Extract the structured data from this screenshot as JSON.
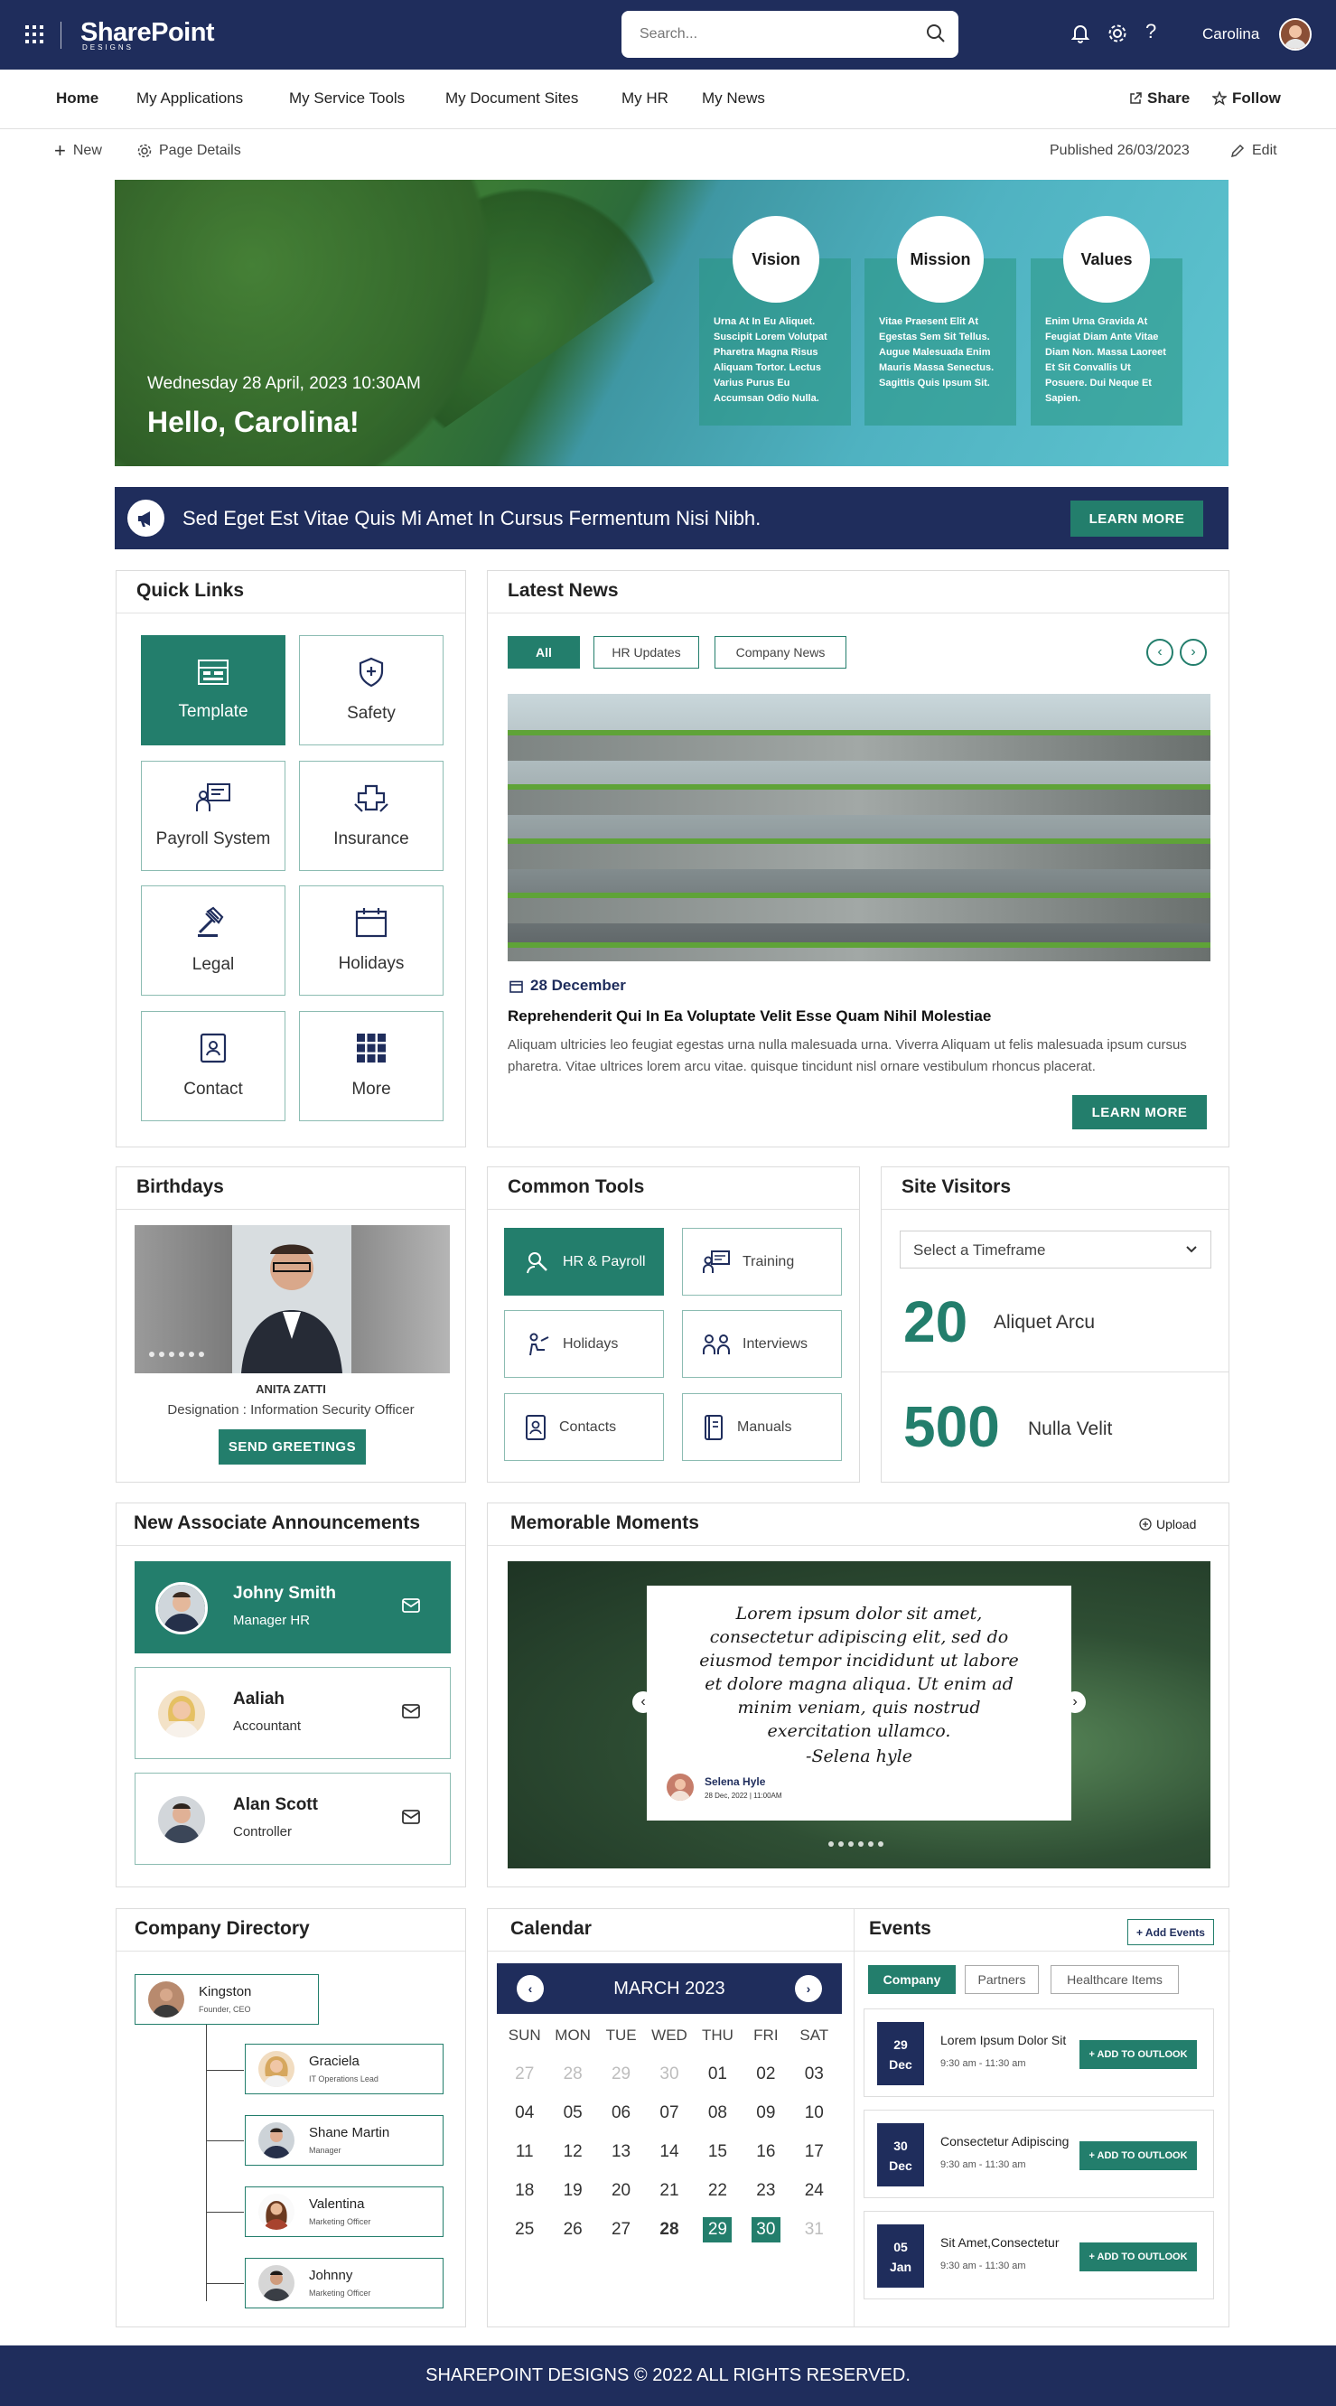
{
  "header": {
    "logo": "SharePoint",
    "logo_sub": "DESIGNS",
    "search_placeholder": "Search...",
    "user_name": "Carolina"
  },
  "nav": {
    "items": [
      "Home",
      "My Applications",
      "My Service Tools",
      "My Document Sites",
      "My HR",
      "My News"
    ],
    "share": "Share",
    "follow": "Follow"
  },
  "commands": {
    "new": "New",
    "page_details": "Page Details",
    "published": "Published 26/03/2023",
    "edit": "Edit"
  },
  "hero": {
    "date": "Wednesday 28 April, 2023  10:30AM",
    "greeting": "Hello, Carolina!",
    "cards": [
      {
        "title": "Vision",
        "text": "Urna At In Eu Aliquet. Suscipit Lorem Volutpat Pharetra Magna Risus Aliquam Tortor. Lectus Varius Purus Eu Accumsan Odio Nulla."
      },
      {
        "title": "Mission",
        "text": "Vitae Praesent Elit At Egestas Sem Sit Tellus. Augue Malesuada Enim Mauris Massa Senectus. Sagittis Quis Ipsum Sit."
      },
      {
        "title": "Values",
        "text": "Enim Urna Gravida At Feugiat Diam Ante Vitae Diam Non. Massa Laoreet Et Sit Convallis Ut Posuere. Dui Neque Et Sapien."
      }
    ]
  },
  "banner": {
    "text": "Sed Eget Est Vitae Quis Mi Amet In Cursus Fermentum Nisi Nibh.",
    "button": "LEARN MORE"
  },
  "quick_links": {
    "title": "Quick Links",
    "items": [
      "Template",
      "Safety",
      "Payroll System",
      "Insurance",
      "Legal",
      "Holidays",
      "Contact",
      "More"
    ]
  },
  "news": {
    "title": "Latest News",
    "filters": [
      "All",
      "HR Updates",
      "Company News"
    ],
    "date": "28 December",
    "headline": "Reprehenderit Qui In Ea Voluptate Velit Esse Quam Nihil Molestiae",
    "body": "Aliquam ultricies leo feugiat egestas urna nulla malesuada urna. Viverra Aliquam ut felis malesuada ipsum cursus pharetra. Vitae ultrices lorem arcu vitae. quisque tincidunt nisl ornare vestibulum rhoncus placerat.",
    "button": "LEARN MORE"
  },
  "birthdays": {
    "title": "Birthdays",
    "name": "ANITA ZATTI",
    "designation": "Designation : Information Security Officer",
    "button": "SEND GREETINGS"
  },
  "tools": {
    "title": "Common Tools",
    "items": [
      "HR & Payroll",
      "Training",
      "Holidays",
      "Interviews",
      "Contacts",
      "Manuals"
    ]
  },
  "visitors": {
    "title": "Site Visitors",
    "select": "Select a Timeframe",
    "stats": [
      {
        "value": "20",
        "label": "Aliquet Arcu"
      },
      {
        "value": "500",
        "label": "Nulla Velit"
      }
    ]
  },
  "associates": {
    "title": "New Associate Announcements",
    "items": [
      {
        "name": "Johny Smith",
        "role": "Manager HR"
      },
      {
        "name": "Aaliah",
        "role": "Accountant"
      },
      {
        "name": "Alan Scott",
        "role": "Controller"
      }
    ]
  },
  "moments": {
    "title": "Memorable Moments",
    "upload": "Upload",
    "quote": "Lorem ipsum dolor sit amet, consectetur adipiscing elit, sed do eiusmod tempor incididunt ut labore et dolore magna aliqua. Ut enim ad minim veniam, quis nostrud exercitation ullamco.",
    "signature": "-Selena hyle",
    "author": "Selena Hyle",
    "author_date": "28 Dec, 2022 | 11:00AM"
  },
  "directory": {
    "title": "Company Directory",
    "root": {
      "name": "Kingston",
      "role": "Founder, CEO"
    },
    "children": [
      {
        "name": "Graciela",
        "role": "IT Operations Lead"
      },
      {
        "name": "Shane Martin",
        "role": "Manager"
      },
      {
        "name": "Valentina",
        "role": "Marketing Officer"
      },
      {
        "name": "Johnny",
        "role": "Marketing Officer"
      }
    ]
  },
  "calendar": {
    "title": "Calendar",
    "month": "MARCH 2023",
    "days": [
      "SUN",
      "MON",
      "TUE",
      "WED",
      "THU",
      "FRI",
      "SAT"
    ],
    "dates": [
      "27",
      "28",
      "29",
      "30",
      "01",
      "02",
      "03",
      "04",
      "05",
      "06",
      "07",
      "08",
      "09",
      "10",
      "11",
      "12",
      "13",
      "14",
      "15",
      "16",
      "17",
      "18",
      "19",
      "20",
      "21",
      "22",
      "23",
      "24",
      "25",
      "26",
      "27",
      "28",
      "29",
      "30",
      "31"
    ]
  },
  "events": {
    "title": "Events",
    "add": "+ Add Events",
    "filters": [
      "Company",
      "Partners",
      "Healthcare Items"
    ],
    "items": [
      {
        "day": "29",
        "month": "Dec",
        "title": "Lorem Ipsum Dolor Sit",
        "time": "9:30 am - 11:30 am",
        "button": "+ ADD TO OUTLOOK"
      },
      {
        "day": "30",
        "month": "Dec",
        "title": "Consectetur Adipiscing",
        "time": "9:30 am - 11:30 am",
        "button": "+ ADD TO OUTLOOK"
      },
      {
        "day": "05",
        "month": "Jan",
        "title": "Sit Amet,Consectetur",
        "time": "9:30 am - 11:30 am",
        "button": "+ ADD TO OUTLOOK"
      }
    ]
  },
  "footer": {
    "text": "SHAREPOINT DESIGNS © 2022 ALL RIGHTS RESERVED."
  },
  "colors": {
    "navy": "#1f2d5c",
    "teal": "#237e6c"
  }
}
